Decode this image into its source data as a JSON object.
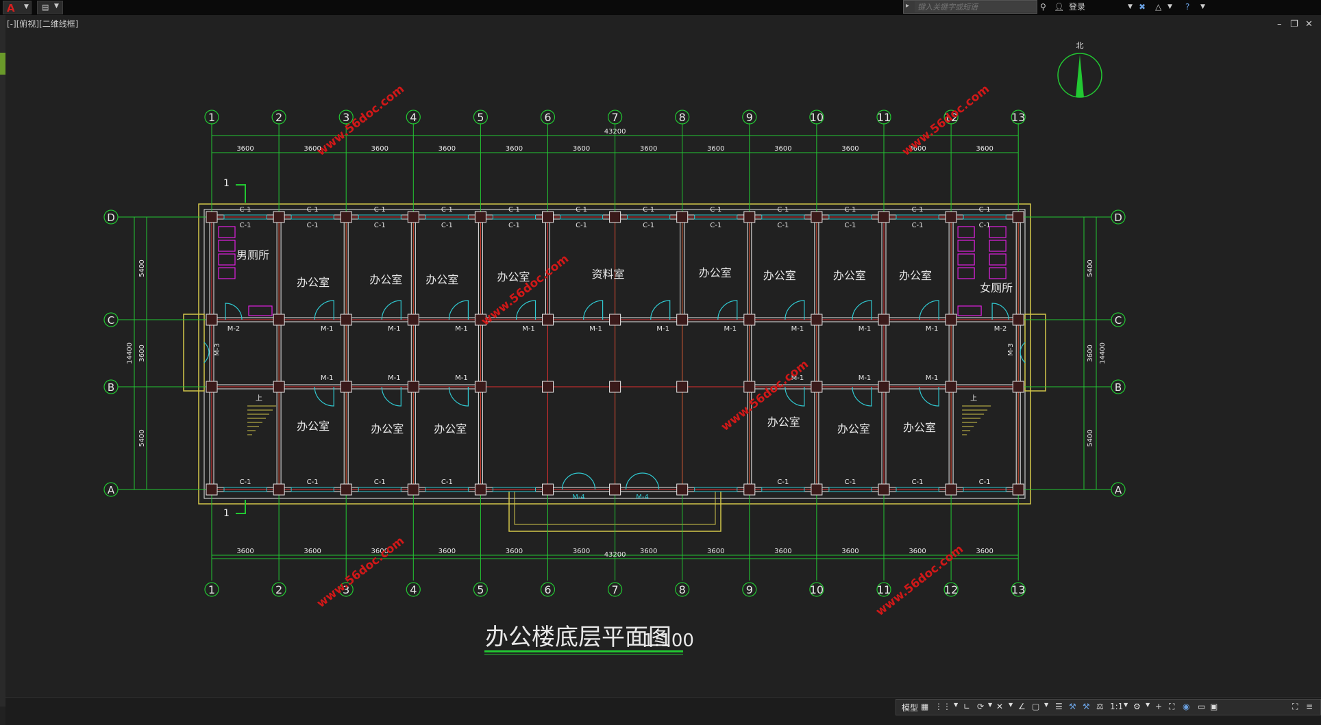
{
  "app": {
    "menu_caret": "▼",
    "quick_access_caret": "▼",
    "search_placeholder": "键入关键字或短语",
    "sign_in_label": "登录",
    "viewport_label": "[-][俯视][二维线框]",
    "window_controls": [
      "–",
      "❐",
      "✕"
    ],
    "accent_color": "#d42020"
  },
  "drawing": {
    "title": "办公楼底层平面图",
    "scale": "1:100",
    "north_label": "北",
    "total_dimension": "43200",
    "bay_dimension": "3600",
    "column_axes": [
      "1",
      "2",
      "3",
      "4",
      "5",
      "6",
      "7",
      "8",
      "9",
      "10",
      "11",
      "12",
      "13"
    ],
    "row_axes": [
      "D",
      "C",
      "B",
      "A"
    ],
    "left_dims": [
      "5400",
      "3600",
      "5400"
    ],
    "left_total": "14400",
    "section_mark": "1",
    "watermark": "www.56doc.com",
    "rooms_top": [
      {
        "label": "男厕所"
      },
      {
        "label": "办公室"
      },
      {
        "label": "办公室"
      },
      {
        "label": "办公室"
      },
      {
        "label": "办公室"
      },
      {
        "label": "资料室"
      },
      {
        "label": "办公室"
      },
      {
        "label": "办公室"
      },
      {
        "label": "办公室"
      },
      {
        "label": "办公室"
      },
      {
        "label": "女厕所"
      }
    ],
    "rooms_bottom": [
      {
        "label": "办公室"
      },
      {
        "label": "办公室"
      },
      {
        "label": "办公室"
      },
      {
        "label": "办公室"
      },
      {
        "label": "办公室"
      },
      {
        "label": "办公室"
      }
    ],
    "window_tag": "C-1",
    "door_tags": {
      "m1": "M-1",
      "m2": "M-2",
      "m3": "M-3",
      "m4": "M-4"
    },
    "stair_label": "上",
    "colors": {
      "axis": "#22c832",
      "wall": "#e8e8e8",
      "red": "#e03030",
      "yellow": "#d4c84a",
      "cyan": "#30c8d0",
      "magenta": "#e020e0",
      "text": "#e8e8e8"
    }
  },
  "status": {
    "model_tab": "模型",
    "scale_ratio": "1:1"
  }
}
